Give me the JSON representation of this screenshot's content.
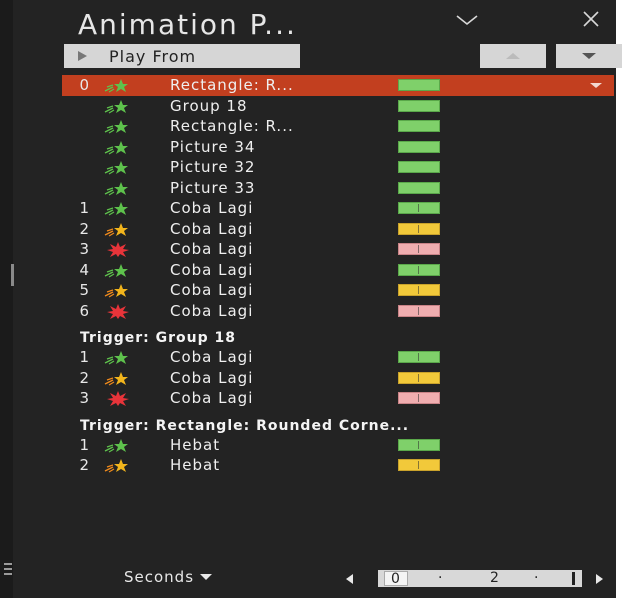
{
  "pane": {
    "title": "Animation P...",
    "play_label": "Play From",
    "icons": [
      "chevron-down-icon",
      "close-icon",
      "play-icon",
      "move-up-icon",
      "move-down-icon"
    ]
  },
  "colors": {
    "selection": "#c23f1f",
    "green": "#7fd06a",
    "yellow": "#f2c93a",
    "red": "#f0aeb0",
    "background": "#232323"
  },
  "main_items": [
    {
      "num": "0",
      "icon": "entrance-effect-icon",
      "label": "Rectangle: R...",
      "bar": "green",
      "split": false,
      "selected": true
    },
    {
      "num": "",
      "icon": "entrance-effect-icon",
      "label": "Group 18",
      "bar": "green",
      "split": false,
      "selected": false
    },
    {
      "num": "",
      "icon": "entrance-effect-icon",
      "label": "Rectangle: R...",
      "bar": "green",
      "split": false,
      "selected": false
    },
    {
      "num": "",
      "icon": "entrance-effect-icon",
      "label": "Picture 34",
      "bar": "green",
      "split": false,
      "selected": false
    },
    {
      "num": "",
      "icon": "entrance-effect-icon",
      "label": "Picture 32",
      "bar": "green",
      "split": false,
      "selected": false
    },
    {
      "num": "",
      "icon": "entrance-effect-icon",
      "label": "Picture 33",
      "bar": "green",
      "split": false,
      "selected": false
    },
    {
      "num": "1",
      "icon": "entrance-effect-icon",
      "label": "Coba Lagi",
      "bar": "green",
      "split": true,
      "selected": false
    },
    {
      "num": "2",
      "icon": "emphasis-effect-icon",
      "label": "Coba Lagi",
      "bar": "yellow",
      "split": true,
      "selected": false
    },
    {
      "num": "3",
      "icon": "exit-effect-icon",
      "label": "Coba Lagi",
      "bar": "red",
      "split": true,
      "selected": false
    },
    {
      "num": "4",
      "icon": "entrance-effect-icon",
      "label": "Coba Lagi",
      "bar": "green",
      "split": true,
      "selected": false
    },
    {
      "num": "5",
      "icon": "emphasis-effect-icon",
      "label": "Coba Lagi",
      "bar": "yellow",
      "split": true,
      "selected": false
    },
    {
      "num": "6",
      "icon": "exit-effect-icon",
      "label": "Coba Lagi",
      "bar": "red",
      "split": true,
      "selected": false
    }
  ],
  "trigger1": {
    "label": "Trigger: Group 18",
    "items": [
      {
        "num": "1",
        "icon": "entrance-effect-icon",
        "label": "Coba Lagi",
        "bar": "green",
        "split": true
      },
      {
        "num": "2",
        "icon": "emphasis-effect-icon",
        "label": "Coba Lagi",
        "bar": "yellow",
        "split": true
      },
      {
        "num": "3",
        "icon": "exit-effect-icon",
        "label": "Coba Lagi",
        "bar": "red",
        "split": true
      }
    ]
  },
  "trigger2": {
    "label": "Trigger: Rectangle: Rounded Corne...",
    "items": [
      {
        "num": "1",
        "icon": "entrance-effect-icon",
        "label": "Hebat",
        "bar": "green",
        "split": true
      },
      {
        "num": "2",
        "icon": "emphasis-effect-icon",
        "label": "Hebat",
        "bar": "yellow",
        "split": true
      }
    ]
  },
  "footer": {
    "seconds_label": "Seconds",
    "ruler_zero": "0",
    "ruler_dot": "·",
    "ruler_two": "2"
  }
}
